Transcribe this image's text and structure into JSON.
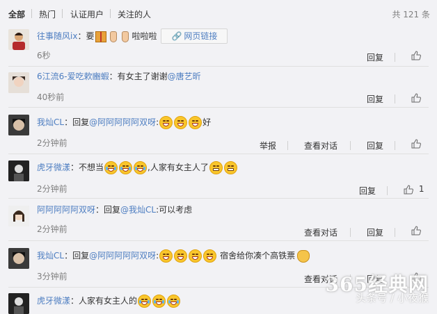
{
  "tabs": [
    "全部",
    "热门",
    "认证用户",
    "关注的人"
  ],
  "total": "共 121 条",
  "actions": {
    "reply": "回复",
    "report": "举报",
    "view_conv": "查看对话"
  },
  "link_button": "网页链接",
  "comments": [
    {
      "user": "往事随风ix",
      "text1": "：要",
      "text2": "啦啦啦",
      "time": "6秒"
    },
    {
      "user": "6江流6-爱吃欶豳蝦",
      "text1": "：有女主了谢谢",
      "mention1": "@唐艺昕",
      "time": "40秒前"
    },
    {
      "user": "我灿CL",
      "text1": "：回复",
      "mention1": "@阿阿阿阿阿双呀",
      "text2": ":",
      "text3": "好",
      "time": "2分钟前"
    },
    {
      "user": "虎牙微漾",
      "text1": "：不想当",
      "text2": ",人家有女主人了",
      "time": "2分钟前",
      "likes": "1"
    },
    {
      "user": "阿阿阿阿阿双呀",
      "text1": "：回复",
      "mention1": "@我灿CL",
      "text2": ":可以考虑",
      "time": "2分钟前"
    },
    {
      "user": "我灿CL",
      "text1": "：回复",
      "mention1": "@阿阿阿阿阿双呀",
      "text2": ":",
      "text3": "宿舍给你凑个高铁票",
      "time": "3分钟前"
    },
    {
      "user": "虎牙微漾",
      "text1": "：人家有女主人的"
    }
  ],
  "watermark": {
    "site": "365经典网",
    "sub": "头条号 / 小夜猴"
  },
  "colors": {
    "link": "#4e7ec1",
    "muted": "#808080",
    "background": "#f2f2f5"
  }
}
